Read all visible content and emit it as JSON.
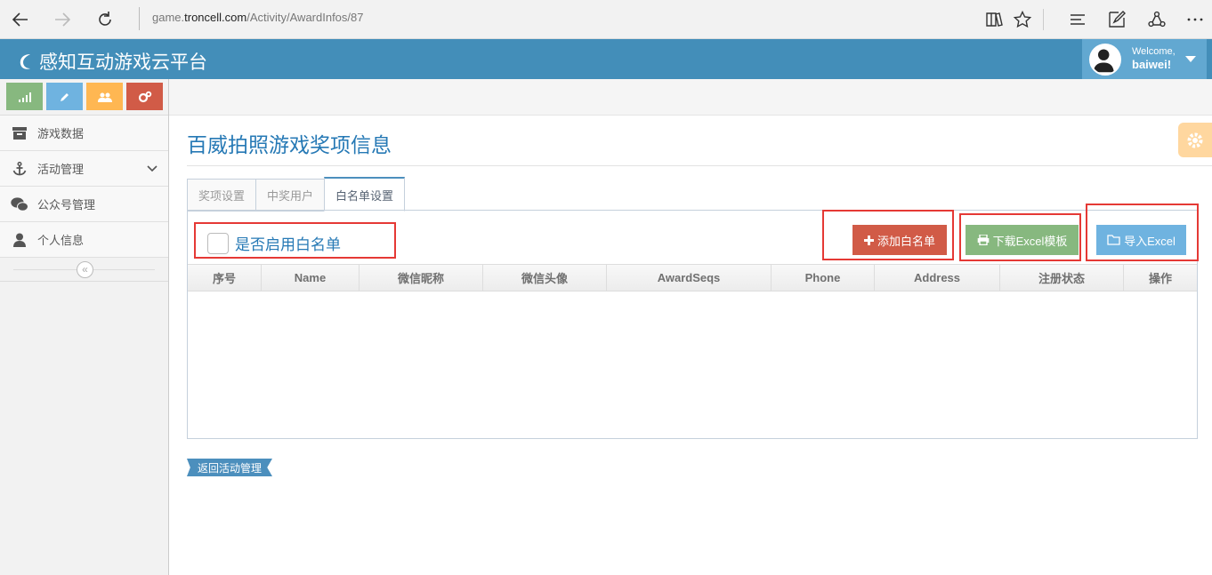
{
  "browser": {
    "url_prefix": "game.",
    "url_domain": "troncell.com",
    "url_path": "/Activity/AwardInfos/87"
  },
  "header": {
    "brand": "感知互动游戏云平台",
    "welcome": "Welcome,",
    "username": "baiwei!"
  },
  "colors": {
    "header_bg": "#438eb9",
    "accent": "#2679b5",
    "shortcut_green": "#87b87f",
    "shortcut_blue": "#6fb3e0",
    "shortcut_orange": "#ffb752",
    "shortcut_red": "#d15b47",
    "highlight": "#e53935"
  },
  "sidebar": {
    "shortcuts": [
      "signal-icon",
      "pencil-icon",
      "users-icon",
      "cogs-icon"
    ],
    "items": [
      {
        "label": "游戏数据",
        "icon": "archive-icon"
      },
      {
        "label": "活动管理",
        "icon": "anchor-icon"
      },
      {
        "label": "公众号管理",
        "icon": "wechat-icon"
      },
      {
        "label": "个人信息",
        "icon": "user-icon"
      }
    ],
    "collapse": "«"
  },
  "main": {
    "title": "百威拍照游戏奖项信息",
    "tabs": [
      "奖项设置",
      "中奖用户",
      "白名单设置"
    ],
    "active_tab": "白名单设置",
    "checkbox_label": "是否启用白名单",
    "buttons": {
      "add_whitelist": "添加白名单",
      "download_template": "下载Excel模板",
      "import_excel": "导入Excel"
    },
    "table": {
      "columns": [
        "序号",
        "Name",
        "微信昵称",
        "微信头像",
        "AwardSeqs",
        "Phone",
        "Address",
        "注册状态",
        "操作"
      ],
      "rows": []
    },
    "back_button": "返回活动管理"
  }
}
